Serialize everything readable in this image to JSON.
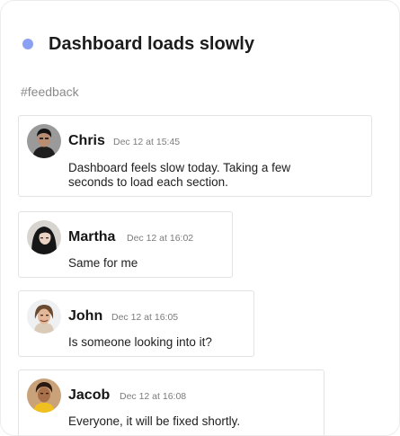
{
  "thread": {
    "title": "Dashboard loads slowly",
    "channel": "#feedback",
    "status_color": "#8aa0f2"
  },
  "messages": [
    {
      "author": "Chris",
      "time": "Dec 12 at 15:45",
      "text_lines": [
        "Dashboard feels slow today. Taking a few",
        "seconds to load each section."
      ],
      "avatar": "person-avatar-chris"
    },
    {
      "author": "Martha",
      "time": "Dec 12 at 16:02",
      "text_lines": [
        "Same for me"
      ],
      "avatar": "person-avatar-martha"
    },
    {
      "author": "John",
      "time": "Dec 12 at 16:05",
      "text_lines": [
        "Is someone looking into it?"
      ],
      "avatar": "person-avatar-john"
    },
    {
      "author": "Jacob",
      "time": "Dec 12 at 16:08",
      "text_lines": [
        "Everyone, it will be fixed shortly."
      ],
      "avatar": "person-avatar-jacob"
    }
  ]
}
